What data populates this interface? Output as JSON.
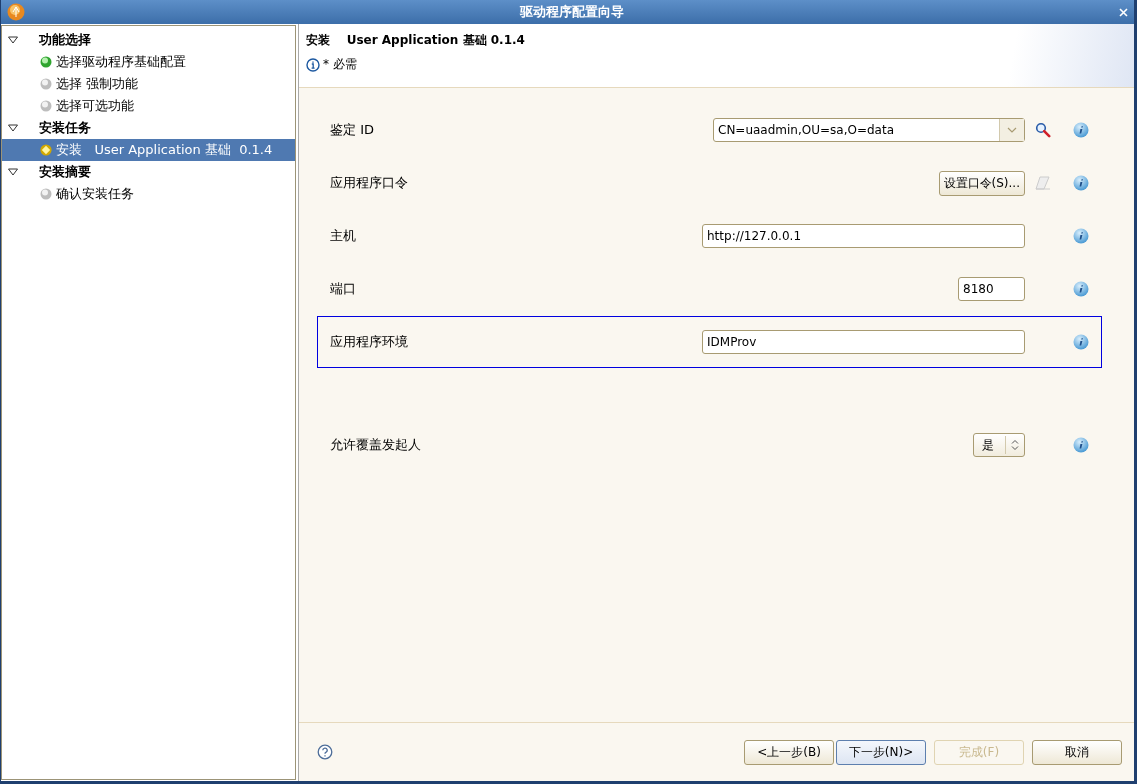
{
  "window": {
    "title": "驱动程序配置向导"
  },
  "tree": [
    {
      "label": "功能选择",
      "expanded": true,
      "children": [
        {
          "label": "选择驱动程序基础配置",
          "kind": "done",
          "selected": false
        },
        {
          "label": "选择 强制功能",
          "kind": "pending",
          "selected": false
        },
        {
          "label": "选择可选功能",
          "kind": "pending",
          "selected": false
        }
      ]
    },
    {
      "label": "安装任务",
      "expanded": true,
      "children": [
        {
          "label": "安装   User Application 基础  0.1.4",
          "kind": "current",
          "selected": true
        }
      ]
    },
    {
      "label": "安装摘要",
      "expanded": true,
      "children": [
        {
          "label": "确认安装任务",
          "kind": "pending",
          "selected": false
        }
      ]
    }
  ],
  "header": {
    "title": "安装    User Application 基础 0.1.4",
    "note": "* 必需"
  },
  "form": [
    {
      "kind": "combo",
      "label": "鉴定 ID",
      "value": "CN=uaadmin,OU=sa,O=data",
      "focused": false
    },
    {
      "kind": "button",
      "label": "应用程序口令",
      "button": "设置口令(S)...",
      "focused": false
    },
    {
      "kind": "text",
      "label": "主机",
      "value": "http://127.0.0.1",
      "focused": false
    },
    {
      "kind": "port",
      "label": "端口",
      "value": "8180",
      "focused": false
    },
    {
      "kind": "text",
      "label": "应用程序环境",
      "value": "IDMProv",
      "focused": true
    },
    {
      "kind": "select",
      "label": "允许覆盖发起人",
      "value": "是",
      "focused": false
    }
  ],
  "buttons": [
    {
      "label": "<上一步(B)",
      "default": false,
      "disabled": false
    },
    {
      "label": "下一步(N)>",
      "default": true,
      "disabled": false
    },
    {
      "label": "完成(F)",
      "default": false,
      "disabled": true
    },
    {
      "label": "取消",
      "default": false,
      "disabled": false
    }
  ]
}
